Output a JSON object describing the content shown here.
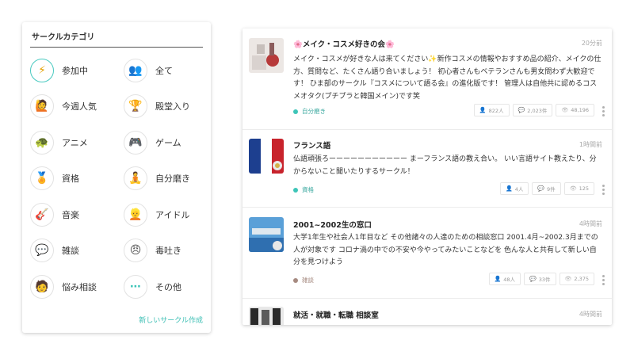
{
  "category_panel": {
    "title": "サークルカテゴリ",
    "new_circle_link": "新しいサークル作成",
    "items": [
      {
        "label": "参加中",
        "icon": "lightning-icon",
        "glyph": "⚡",
        "active": true
      },
      {
        "label": "全て",
        "icon": "people-group-icon",
        "glyph": "👥"
      },
      {
        "label": "今週人気",
        "icon": "popular-person-icon",
        "glyph": "🙋"
      },
      {
        "label": "殿堂入り",
        "icon": "trophy-person-icon",
        "glyph": "🏆"
      },
      {
        "label": "アニメ",
        "icon": "anime-icon",
        "glyph": "🐢"
      },
      {
        "label": "ゲーム",
        "icon": "game-controller-icon",
        "glyph": "🎮"
      },
      {
        "label": "資格",
        "icon": "certificate-icon",
        "glyph": "🏅"
      },
      {
        "label": "自分磨き",
        "icon": "self-improvement-icon",
        "glyph": "🧘"
      },
      {
        "label": "音楽",
        "icon": "guitar-icon",
        "glyph": "🎸"
      },
      {
        "label": "アイドル",
        "icon": "idol-icon",
        "glyph": "👱"
      },
      {
        "label": "雑談",
        "icon": "chat-people-icon",
        "glyph": "💬"
      },
      {
        "label": "毒吐き",
        "icon": "angry-face-icon",
        "glyph": "😠"
      },
      {
        "label": "悩み相談",
        "icon": "consult-person-icon",
        "glyph": "🧑"
      },
      {
        "label": "その他",
        "icon": "more-dots-icon",
        "glyph": "⋯"
      }
    ]
  },
  "circles": [
    {
      "title": "🌸メイク・コスメ好きの会🌸",
      "time": "20分前",
      "description": "メイク・コスメが好きな人は来てください✨新作コスメの情報やおすすめ品の紹介、メイクの仕方、質問など、たくさん語り合いましょう！ 初心者さんもベテランさんも男女問わず大歓迎です！ ひま部のサークル『コスメについて語る会』の進化版です！ 管理人は自他共に認めるコスメオタク(プチプラと韓国メイン)です笑",
      "tag": "自分磨き",
      "tag_color": "#3ec5b8",
      "members": "822人",
      "comments": "2,023件",
      "views": "48,196",
      "thumb_colors": [
        "#d9d2cf",
        "#b73a3a",
        "#ece7e4"
      ]
    },
    {
      "title": "フランス語",
      "time": "1時間前",
      "description": "仏語頑張ろーーーーーーーーーーー まーフランス語の教え合い。 いい言語サイト教えたり、分からないこと聞いたりするサークル！",
      "tag": "資格",
      "tag_color": "#3ec5b8",
      "members": "4人",
      "comments": "9件",
      "views": "125",
      "thumb_colors": [
        "#1d3f8f",
        "#ffffff",
        "#c8232c"
      ]
    },
    {
      "title": "2001~2002生の窓口",
      "time": "4時間前",
      "description": "大学1年生や社会人1年目など その他諸々の人達のための相談窓口 2001.4月~2002.3月までの人が対象です コロナ渦の中での不安や今やってみたいことなどを 色んな人と共有して新しい自分を見つけよう",
      "tag": "雑談",
      "tag_color": "#a68a80",
      "members": "48人",
      "comments": "33件",
      "views": "2,375",
      "thumb_colors": [
        "#5aa0d8",
        "#2f6fb0",
        "#dfe8ef"
      ]
    },
    {
      "title": "就活・就職・転職 相談室",
      "time": "4時間前",
      "thumb_colors": [
        "#2a2a2a",
        "#5b5b5b",
        "#e8e8e8"
      ]
    }
  ],
  "icons": {
    "members": "person-icon",
    "comments": "comment-icon",
    "views": "eye-icon",
    "more": "more-vertical-icon"
  },
  "colors": {
    "accent": "#3ec5b8",
    "active_border": "#48c9c0"
  }
}
